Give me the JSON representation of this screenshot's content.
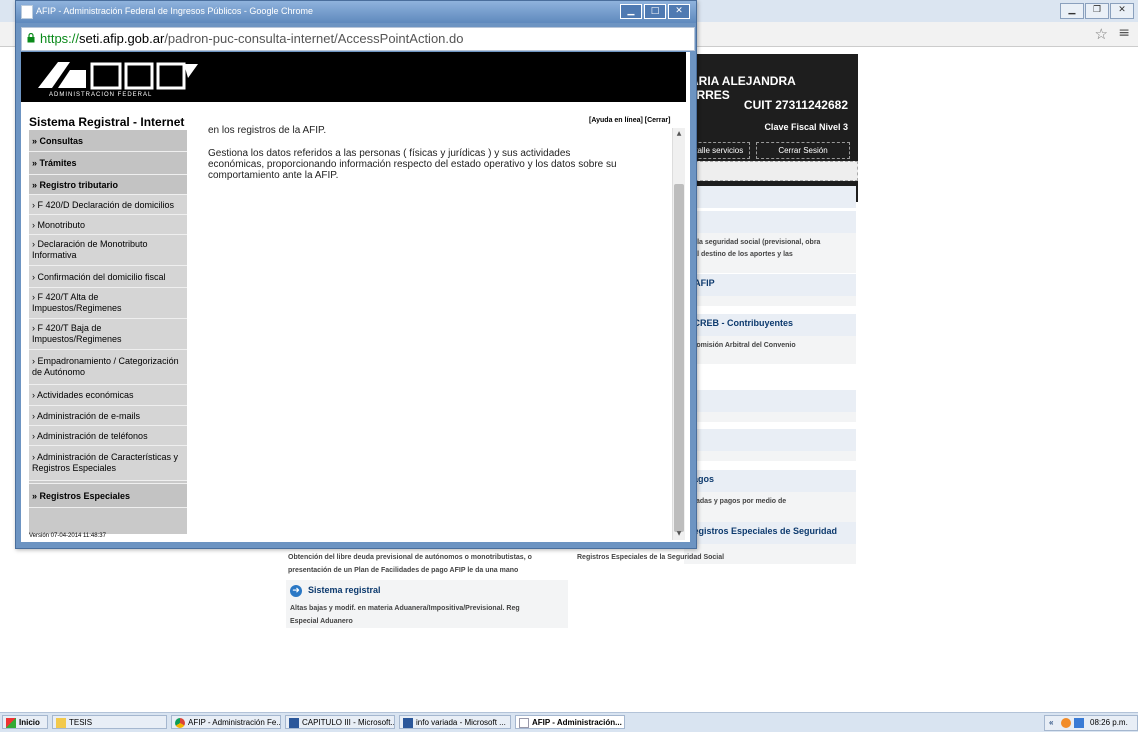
{
  "background_browser": {
    "user": {
      "name": "MARIA ALEJANDRA TORRES",
      "cuit": "CUIT 27311242682",
      "clave": "Clave Fiscal Nivel 3"
    },
    "buttons": [
      "etalle servicios",
      "Cerrar Sesión"
    ],
    "right_boxes": [
      {
        "title": "",
        "text": "en la seguridad social (previsional, obra\no al destino de los aportes y las"
      },
      {
        "title": "e AFIP",
        "text": ""
      },
      {
        "title": "RCREB - Contribuyentes",
        "text": "- Comisión Arbitral del Convenio"
      },
      {
        "title": "",
        "text": ""
      },
      {
        "title": "",
        "text": ""
      },
      {
        "title": "Pagos",
        "text": "juradas y pagos por medio de\ns"
      },
      {
        "title": "Registros Especiales de Seguridad",
        "text": ""
      }
    ],
    "bottom": {
      "text1": "Obtención del libre deuda previsional de autónomos o monotributistas, o\npresentación de un Plan de Facilidades de pago AFIP le da una mano",
      "text2": "Registros Especiales de la Seguridad Social",
      "section_title": "Sistema registral",
      "section_text": "Altas bajas y modif. en materia Aduanera/Impositiva/Previsional. Reg\nEspecial Aduanero"
    }
  },
  "popup": {
    "title": "AFIP - Administración Federal de Ingresos Públicos - Google Chrome",
    "url_scheme": "https://",
    "url_host": "seti.afip.gob.ar",
    "url_path": "/padron-puc-consulta-internet/AccessPointAction.do",
    "afip_subtitle": "ADMINISTRACION FEDERAL",
    "system_title": "Sistema Registral - Internet",
    "links": {
      "help": "[Ayuda en línea]",
      "close": "[Cerrar]"
    },
    "content": {
      "line0": "en los registros de la AFIP.",
      "paragraph": "Gestiona los datos referidos a las personas ( físicas y jurídicas ) y sus actividades\neconómicas, proporcionando información respecto del estado operativo y los datos sobre su\ncomportamiento ante la AFIP."
    },
    "menu": [
      {
        "label": "» Consultas",
        "type": "section"
      },
      {
        "label": "» Trámites",
        "type": "section"
      },
      {
        "label": "» Registro tributario",
        "type": "section"
      },
      {
        "label": "› F 420/D Declaración de domicilios",
        "type": "sub"
      },
      {
        "label": "› Monotributo",
        "type": "sub"
      },
      {
        "label": "› Declaración de Monotributo\nInformativa",
        "type": "sub"
      },
      {
        "label": "› Confirmación del domicilio fiscal",
        "type": "sub"
      },
      {
        "label": "› F 420/T Alta de\nImpuestos/Regimenes",
        "type": "sub"
      },
      {
        "label": "› F 420/T Baja de\nImpuestos/Regimenes",
        "type": "sub"
      },
      {
        "label": "› Empadronamiento / Categorización\nde Autónomo",
        "type": "sub"
      },
      {
        "label": "› Actividades económicas",
        "type": "sub"
      },
      {
        "label": "› Administración de e-mails",
        "type": "sub"
      },
      {
        "label": "› Administración de teléfonos",
        "type": "sub"
      },
      {
        "label": "› Administración de Características y\nRegistros Especiales",
        "type": "sub"
      },
      {
        "label": "» Registros Especiales",
        "type": "section"
      }
    ],
    "version": "Versión 07-04-2014 11:48:37"
  },
  "taskbar": {
    "start": "Inicio",
    "items": [
      {
        "label": "TESIS",
        "icon": "folder-icon"
      },
      {
        "label": "AFIP - Administración Fe...",
        "icon": "chrome-icon"
      },
      {
        "label": "CAPITULO III - Microsoft...",
        "icon": "word-icon"
      },
      {
        "label": "info variada - Microsoft ...",
        "icon": "word-icon"
      },
      {
        "label": "AFIP - Administración...",
        "icon": "page-icon"
      }
    ],
    "clock": "08:26 p.m."
  }
}
